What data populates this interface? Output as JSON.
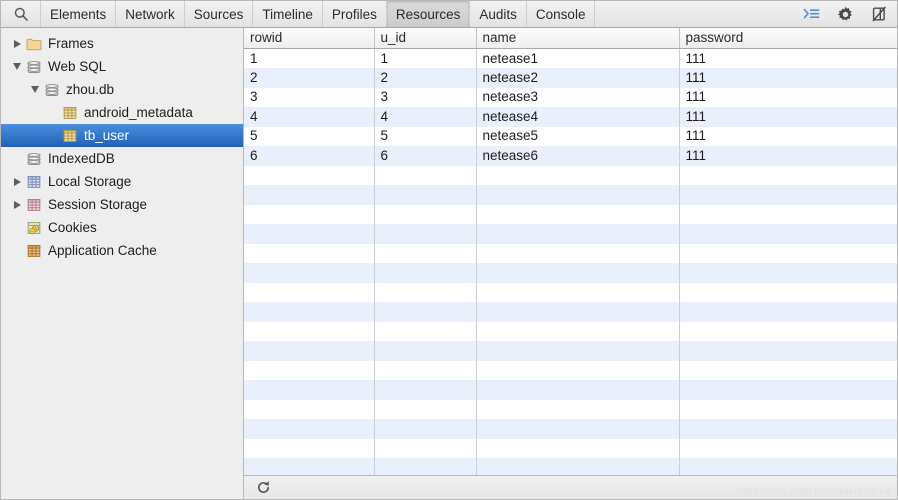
{
  "toolbar": {
    "search_icon": "search-icon",
    "tabs": [
      {
        "label": "Elements",
        "active": false
      },
      {
        "label": "Network",
        "active": false
      },
      {
        "label": "Sources",
        "active": false
      },
      {
        "label": "Timeline",
        "active": false
      },
      {
        "label": "Profiles",
        "active": false
      },
      {
        "label": "Resources",
        "active": true
      },
      {
        "label": "Audits",
        "active": false
      },
      {
        "label": "Console",
        "active": false
      }
    ],
    "right_icons": [
      {
        "name": "console-drawer-icon",
        "color": "#5b8fd0"
      },
      {
        "name": "gear-icon",
        "color": "#4a4a4a"
      },
      {
        "name": "dock-disabled-icon",
        "color": "#4a4a4a"
      }
    ]
  },
  "sidebar": {
    "items": [
      {
        "label": "Frames",
        "indent": 0,
        "twisty": "collapsed",
        "icon": "folder-icon",
        "selected": false
      },
      {
        "label": "Web SQL",
        "indent": 0,
        "twisty": "expanded",
        "icon": "database-icon",
        "selected": false
      },
      {
        "label": "zhou.db",
        "indent": 1,
        "twisty": "expanded",
        "icon": "database-icon",
        "selected": false
      },
      {
        "label": "android_metadata",
        "indent": 2,
        "twisty": "none",
        "icon": "table-icon",
        "selected": false
      },
      {
        "label": "tb_user",
        "indent": 2,
        "twisty": "none",
        "icon": "table-icon",
        "selected": true
      },
      {
        "label": "IndexedDB",
        "indent": 0,
        "twisty": "none",
        "icon": "database-icon",
        "selected": false
      },
      {
        "label": "Local Storage",
        "indent": 0,
        "twisty": "collapsed",
        "icon": "storage-blue-icon",
        "selected": false
      },
      {
        "label": "Session Storage",
        "indent": 0,
        "twisty": "collapsed",
        "icon": "storage-pink-icon",
        "selected": false
      },
      {
        "label": "Cookies",
        "indent": 0,
        "twisty": "none",
        "icon": "cookies-icon",
        "selected": false
      },
      {
        "label": "Application Cache",
        "indent": 0,
        "twisty": "none",
        "icon": "appcache-icon",
        "selected": false
      }
    ]
  },
  "table": {
    "columns": [
      "rowid",
      "u_id",
      "name",
      "password"
    ],
    "rows": [
      [
        "1",
        "1",
        "netease1",
        "111"
      ],
      [
        "2",
        "2",
        "netease2",
        "111"
      ],
      [
        "3",
        "3",
        "netease3",
        "111"
      ],
      [
        "4",
        "4",
        "netease4",
        "111"
      ],
      [
        "5",
        "5",
        "netease5",
        "111"
      ],
      [
        "6",
        "6",
        "netease6",
        "111"
      ]
    ],
    "empty_row_count": 17
  },
  "statusbar": {
    "refresh_icon": "refresh-icon"
  },
  "watermark": {
    "text": "https://blog.csdn.net/coderinchina"
  },
  "colors": {
    "selection_blue_top": "#4a8ede",
    "selection_blue_bottom": "#1f62b8",
    "row_stripe": "#eaf0fb",
    "sidebar_bg": "#eeeeee",
    "toolbar_bg": "#e9e9e9"
  }
}
